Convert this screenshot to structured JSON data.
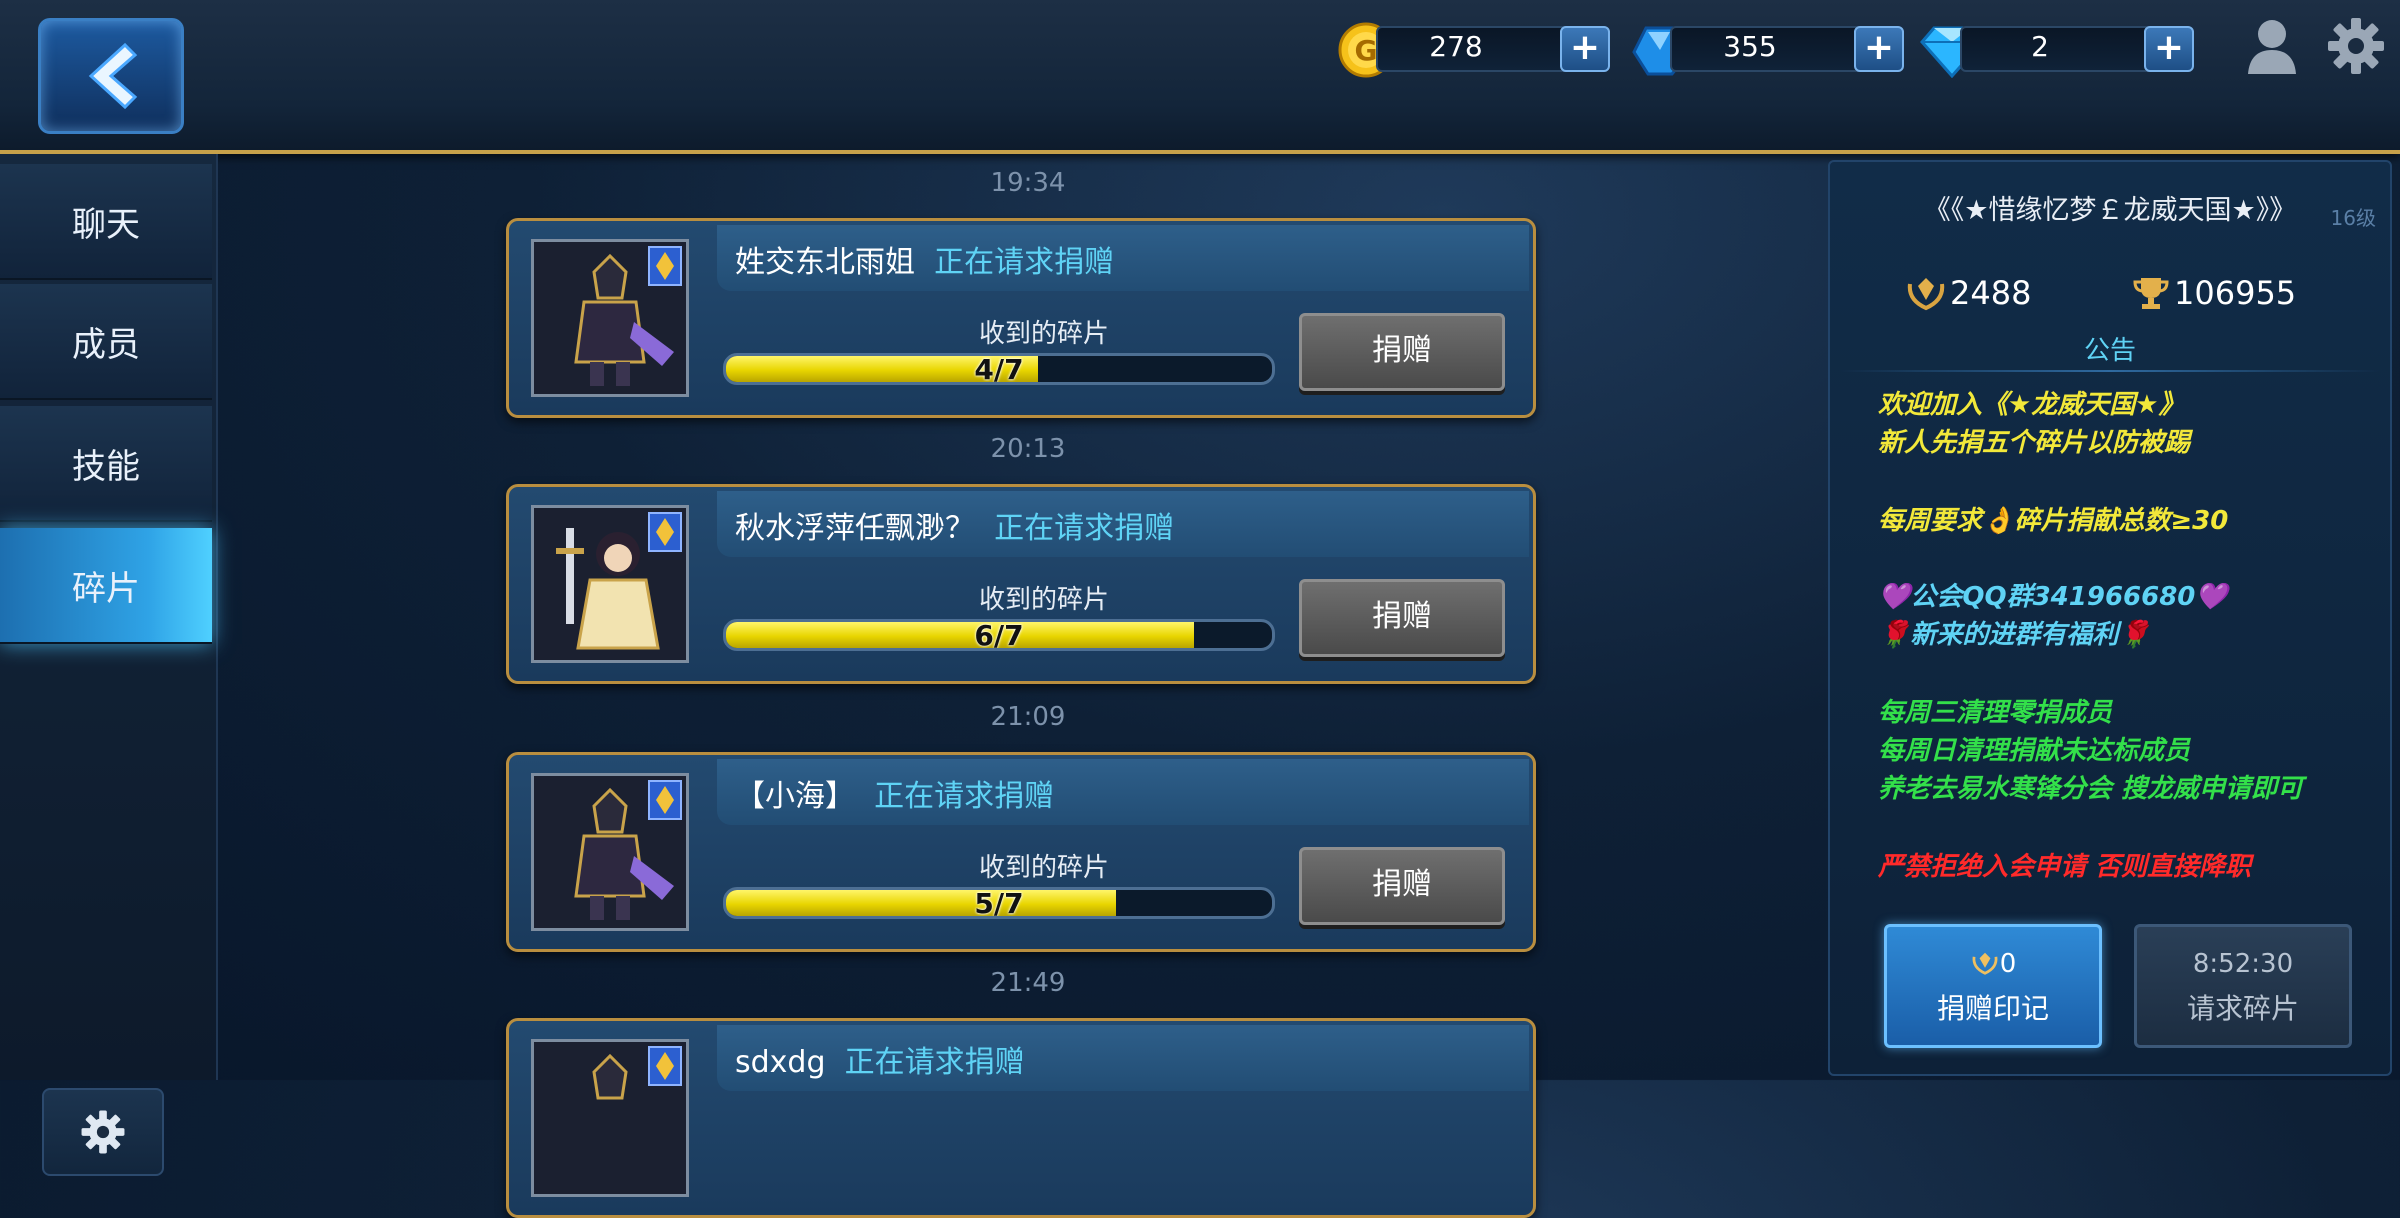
{
  "currencies": [
    {
      "name": "gold",
      "icon": "gold-coin-icon",
      "value": "278"
    },
    {
      "name": "crystal",
      "icon": "blue-crystal-icon",
      "value": "355"
    },
    {
      "name": "diamond",
      "icon": "diamond-icon",
      "value": "2"
    }
  ],
  "sidebar": {
    "tabs": [
      {
        "label": "聊天"
      },
      {
        "label": "成员"
      },
      {
        "label": "技能"
      },
      {
        "label": "碎片"
      }
    ],
    "active_index": 3
  },
  "requests": [
    {
      "time": "19:34",
      "name": "姓交东北雨姐",
      "status": "正在请求捐赠",
      "received_label": "收到的碎片",
      "progress_text": "4/7",
      "progress": 0.571,
      "button": "捐赠",
      "avatar": "dark-knight"
    },
    {
      "time": "20:13",
      "name": "秋水浮萍任飘渺？",
      "status": "正在请求捐赠",
      "received_label": "收到的碎片",
      "progress_text": "6/7",
      "progress": 0.857,
      "button": "捐赠",
      "avatar": "sword-princess"
    },
    {
      "time": "21:09",
      "name": "【小海】",
      "status": "正在请求捐赠",
      "received_label": "收到的碎片",
      "progress_text": "5/7",
      "progress": 0.714,
      "button": "捐赠",
      "avatar": "dark-knight"
    },
    {
      "time": "21:49",
      "name": "sdxdg",
      "status": "正在请求捐赠",
      "received_label": "",
      "progress_text": "",
      "progress": 0,
      "button": "",
      "avatar": "dark-knight"
    }
  ],
  "guild": {
    "title": "《《★惜缘忆梦￡龙威天国★》》",
    "level": "16级",
    "stat1": "2488",
    "stat2": "106955",
    "notice_title": "公告",
    "notice_lines": [
      {
        "text": "欢迎加入《★龙威天国★》",
        "color": "#f2e83a"
      },
      {
        "text": "新人先捐五个碎片以防被踢",
        "color": "#f2e83a"
      },
      {
        "text": "每周要求👌碎片捐献总数≥30",
        "color": "#f2e83a"
      },
      {
        "text": "💜公会QQ群341966680💜",
        "color": "#5fd3f5"
      },
      {
        "text": "🌹新来的进群有福利🌹",
        "color": "#5fd3f5"
      },
      {
        "text": "每周三清理零捐成员",
        "color": "#33e04a"
      },
      {
        "text": "每周日清理捐献未达标成员",
        "color": "#33e04a"
      },
      {
        "text": "养老去易水寒锋分会 搜龙威申请即可",
        "color": "#33e04a"
      },
      {
        "text": "严禁拒绝入会申请 否则直接降职",
        "color": "#ff2a2a"
      }
    ],
    "donate_mark_count": "0",
    "donate_mark_label": "捐赠印记",
    "request_timer": "8:52:30",
    "request_label": "请求碎片"
  }
}
